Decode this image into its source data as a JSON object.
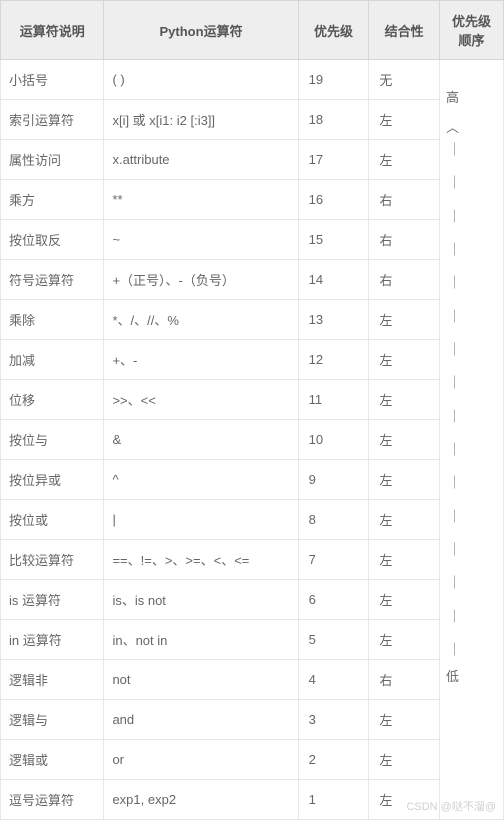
{
  "headers": {
    "desc": "运算符说明",
    "python": "Python运算符",
    "priority": "优先级",
    "assoc": "结合性",
    "order": "优先级顺序"
  },
  "rows": [
    {
      "desc": "小括号",
      "python": "( )",
      "priority": "19",
      "assoc": "无"
    },
    {
      "desc": "索引运算符",
      "python": "x[i] 或 x[i1: i2 [:i3]]",
      "priority": "18",
      "assoc": "左"
    },
    {
      "desc": "属性访问",
      "python": "x.attribute",
      "priority": "17",
      "assoc": "左"
    },
    {
      "desc": "乘方",
      "python": "**",
      "priority": "16",
      "assoc": "右"
    },
    {
      "desc": "按位取反",
      "python": "~",
      "priority": "15",
      "assoc": "右"
    },
    {
      "desc": "符号运算符",
      "python": "+（正号）、-（负号）",
      "priority": "14",
      "assoc": "右"
    },
    {
      "desc": "乘除",
      "python": "*、/、//、%",
      "priority": "13",
      "assoc": "左"
    },
    {
      "desc": "加减",
      "python": "+、-",
      "priority": "12",
      "assoc": "左"
    },
    {
      "desc": "位移",
      "python": ">>、<<",
      "priority": "11",
      "assoc": "左"
    },
    {
      "desc": "按位与",
      "python": "&",
      "priority": "10",
      "assoc": "左"
    },
    {
      "desc": "按位异或",
      "python": "^",
      "priority": "9",
      "assoc": "左"
    },
    {
      "desc": "按位或",
      "python": "|",
      "priority": "8",
      "assoc": "左"
    },
    {
      "desc": "比较运算符",
      "python": "==、!=、>、>=、<、<=",
      "priority": "7",
      "assoc": "左"
    },
    {
      "desc": "is 运算符",
      "python": "is、is not",
      "priority": "6",
      "assoc": "左"
    },
    {
      "desc": "in 运算符",
      "python": "in、not in",
      "priority": "5",
      "assoc": "左"
    },
    {
      "desc": "逻辑非",
      "python": "not",
      "priority": "4",
      "assoc": "右"
    },
    {
      "desc": "逻辑与",
      "python": "and",
      "priority": "3",
      "assoc": "左"
    },
    {
      "desc": "逻辑或",
      "python": "or",
      "priority": "2",
      "assoc": "左"
    },
    {
      "desc": "逗号运算符",
      "python": "exp1, exp2",
      "priority": "1",
      "assoc": "左"
    }
  ],
  "order_col": {
    "high": "高",
    "caret": "︿",
    "dash": "｜",
    "low": "低"
  },
  "watermark": "CSDN @哒不溜@"
}
